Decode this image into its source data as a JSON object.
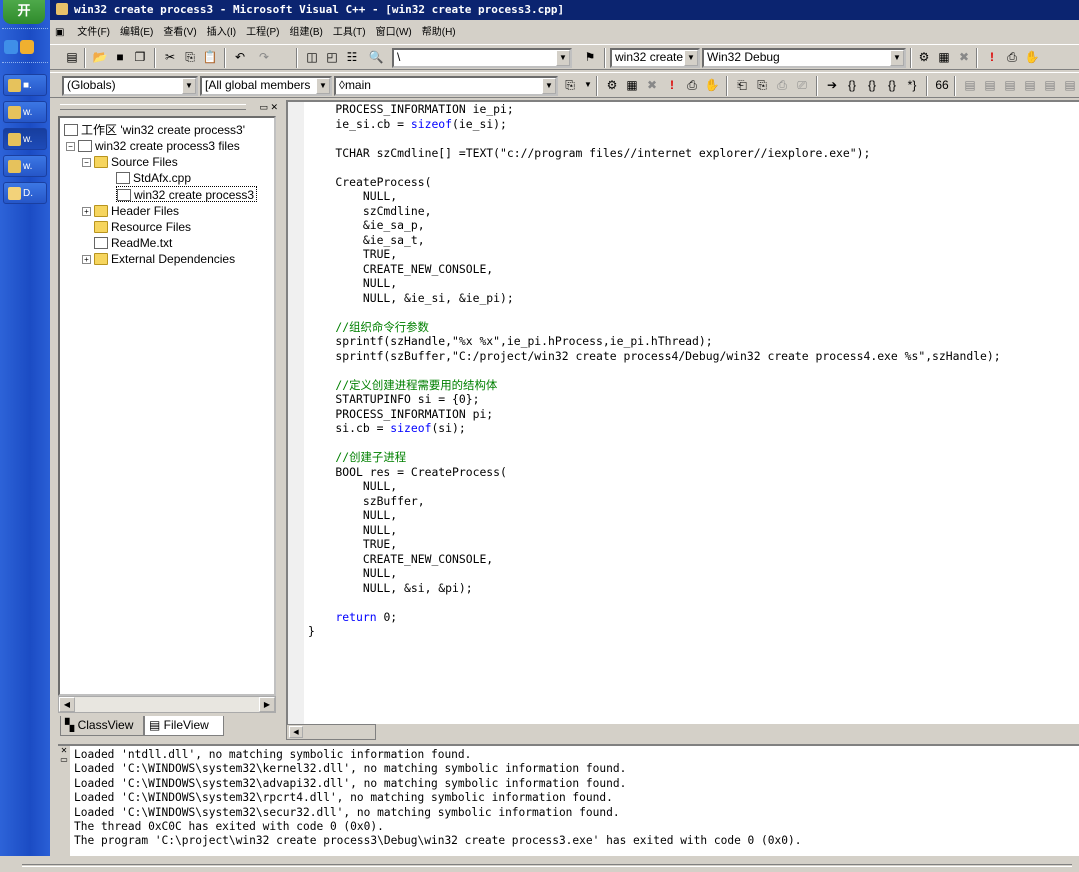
{
  "taskbar": {
    "start_label": "开",
    "quick_items": [
      {
        "label": "e",
        "color": "#3f8fe8"
      },
      {
        "label": "≈",
        "color": "#f0b030"
      }
    ],
    "tasks": [
      {
        "label": "■.",
        "active": false,
        "color": "#e6c25c"
      },
      {
        "label": "w.",
        "active": false,
        "color": "#e6c25c"
      },
      {
        "label": "w.",
        "active": true,
        "color": "#e6c25c"
      },
      {
        "label": "w.",
        "active": false,
        "color": "#e6c25c"
      },
      {
        "label": "D.",
        "active": false,
        "color": "#f2d27a"
      }
    ]
  },
  "window": {
    "title": "win32 create process3 - Microsoft Visual C++ - [win32 create process3.cpp]"
  },
  "menu": {
    "items": [
      "文件(F)",
      "编辑(E)",
      "查看(V)",
      "插入(I)",
      "工程(P)",
      "组建(B)",
      "工具(T)",
      "窗口(W)",
      "帮助(H)"
    ]
  },
  "toolbar1": {
    "find_value": "\\",
    "config_project": "win32 create",
    "config_build": "Win32 Debug"
  },
  "toolbar2": {
    "scope": "(Globals)",
    "members": "[All global members",
    "function": "main"
  },
  "workspace": {
    "root": "工作区 'win32 create process3'",
    "project": "win32 create process3 files",
    "source_files": "Source Files",
    "stdafx": "StdAfx.cpp",
    "main_file": "win32 create process3",
    "header_files": "Header Files",
    "resource_files": "Resource Files",
    "readme": "ReadMe.txt",
    "external": "External Dependencies",
    "tab_class": "ClassView",
    "tab_file": "FileView"
  },
  "editor": {
    "lines": [
      "    PROCESS_INFORMATION ie_pi;",
      "    ie_si.cb = sizeof(ie_si);",
      "",
      "    TCHAR szCmdline[] =TEXT(\"c://program files//internet explorer//iexplore.exe\");",
      "",
      "    CreateProcess(",
      "        NULL,",
      "        szCmdline,",
      "        &ie_sa_p,",
      "        &ie_sa_t,",
      "        TRUE,",
      "        CREATE_NEW_CONSOLE,",
      "        NULL,",
      "        NULL, &ie_si, &ie_pi);",
      "",
      "    //组织命令行参数",
      "    sprintf(szHandle,\"%x %x\",ie_pi.hProcess,ie_pi.hThread);",
      "    sprintf(szBuffer,\"C:/project/win32 create process4/Debug/win32 create process4.exe %s\",szHandle);",
      "",
      "    //定义创建进程需要用的结构体",
      "    STARTUPINFO si = {0};",
      "    PROCESS_INFORMATION pi;",
      "    si.cb = sizeof(si);",
      "",
      "    //创建子进程",
      "    BOOL res = CreateProcess(",
      "        NULL,",
      "        szBuffer,",
      "        NULL,",
      "        NULL,",
      "        TRUE,",
      "        CREATE_NEW_CONSOLE,",
      "        NULL,",
      "        NULL, &si, &pi);",
      "",
      "    return 0;",
      "}"
    ]
  },
  "output": {
    "lines": [
      "Loaded 'ntdll.dll', no matching symbolic information found.",
      "Loaded 'C:\\WINDOWS\\system32\\kernel32.dll', no matching symbolic information found.",
      "Loaded 'C:\\WINDOWS\\system32\\advapi32.dll', no matching symbolic information found.",
      "Loaded 'C:\\WINDOWS\\system32\\rpcrt4.dll', no matching symbolic information found.",
      "Loaded 'C:\\WINDOWS\\system32\\secur32.dll', no matching symbolic information found.",
      "The thread 0xC0C has exited with code 0 (0x0).",
      "The program 'C:\\project\\win32 create process3\\Debug\\win32 create process3.exe' has exited with code 0 (0x0)."
    ]
  }
}
